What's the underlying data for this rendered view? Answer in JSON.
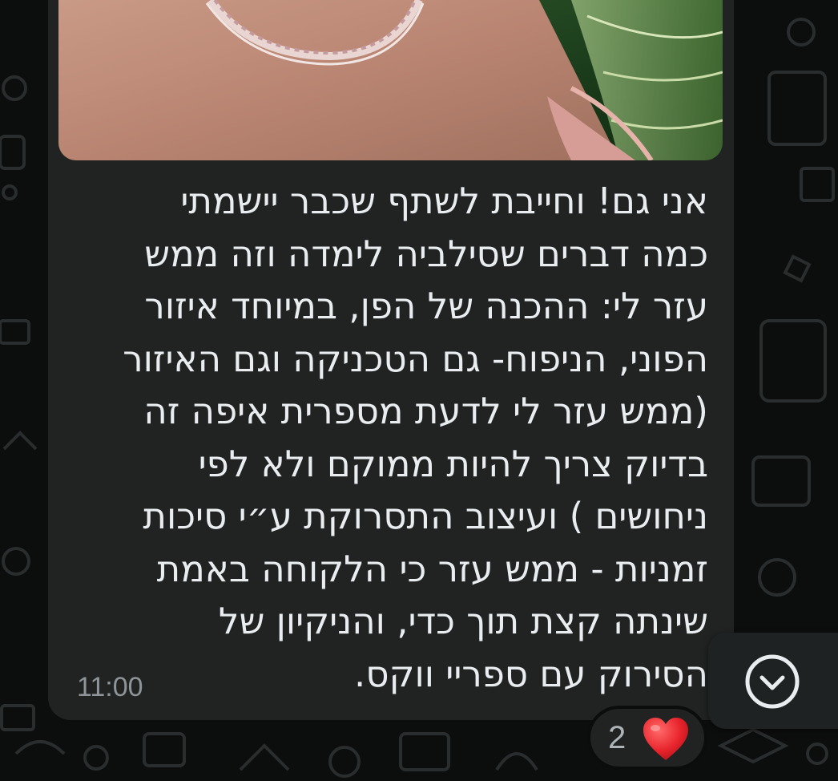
{
  "message": {
    "text_lines": [
      "אני גם! וחייבת לשתף שכבר יישמתי",
      "כמה דברים שסילביה לימדה וזה ממש",
      "עזר לי: ההכנה של הפן, במיוחד איזור",
      "הפוני, הניפוח- גם הטכניקה וגם האיזור",
      "(ממש עזר לי לדעת מספרית איפה זה",
      "בדיוק צריך להיות ממוקם ולא לפי",
      "ניחושים ) ועיצוב התסרוקת ע״י סיכות",
      "זמניות - ממש עזר כי הלקוחה באמת",
      "שינתה קצת תוך כדי, והניקיון של",
      "הסירוק עם ספריי ווקס."
    ],
    "timestamp": "11:00"
  },
  "reaction": {
    "count": "2",
    "emoji": "heart-emoji"
  },
  "controls": {
    "scroll_down_icon": "chevron-down-circle-icon"
  },
  "colors": {
    "bubble": "#202322",
    "text": "#e9edef",
    "timestamp": "#8e9497",
    "heart": "#e8242c",
    "background": "#0c0d0d"
  }
}
